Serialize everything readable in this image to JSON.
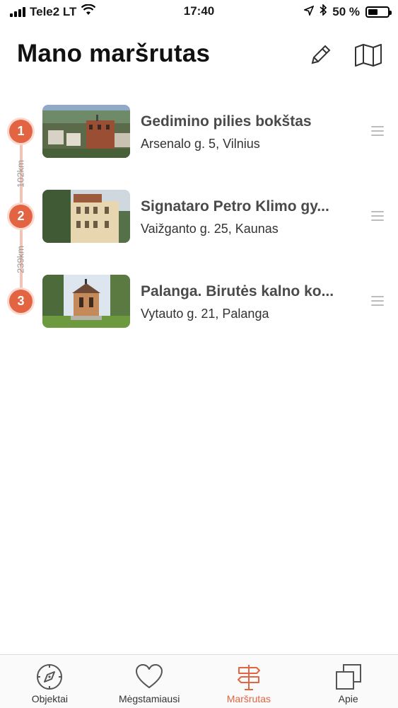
{
  "status_bar": {
    "carrier": "Tele2 LT",
    "time": "17:40",
    "battery_percent_text": "50 %",
    "battery_level": 0.5
  },
  "header": {
    "title": "Mano maršrutas",
    "edit_icon": "pencil-icon",
    "map_icon": "map-icon"
  },
  "route": {
    "items": [
      {
        "number": "1",
        "title": "Gedimino pilies bokštas",
        "address": "Arsenalo g. 5, Vilnius"
      },
      {
        "number": "2",
        "title": "Signataro Petro Klimo gy...",
        "address": "Vaižganto g. 25, Kaunas"
      },
      {
        "number": "3",
        "title": "Palanga. Birutės kalno ko...",
        "address": "Vytauto g. 21, Palanga"
      }
    ],
    "distances": [
      "102km",
      "239km"
    ]
  },
  "tabs": [
    {
      "label": "Objektai",
      "icon": "compass-icon",
      "active": false
    },
    {
      "label": "Mėgstamiausi",
      "icon": "heart-icon",
      "active": false
    },
    {
      "label": "Maršrutas",
      "icon": "signpost-icon",
      "active": true
    },
    {
      "label": "Apie",
      "icon": "copy-icon",
      "active": false
    }
  ],
  "colors": {
    "accent": "#e26442",
    "route_line": "#f0c4b6",
    "text_title": "#4a4a4a"
  }
}
